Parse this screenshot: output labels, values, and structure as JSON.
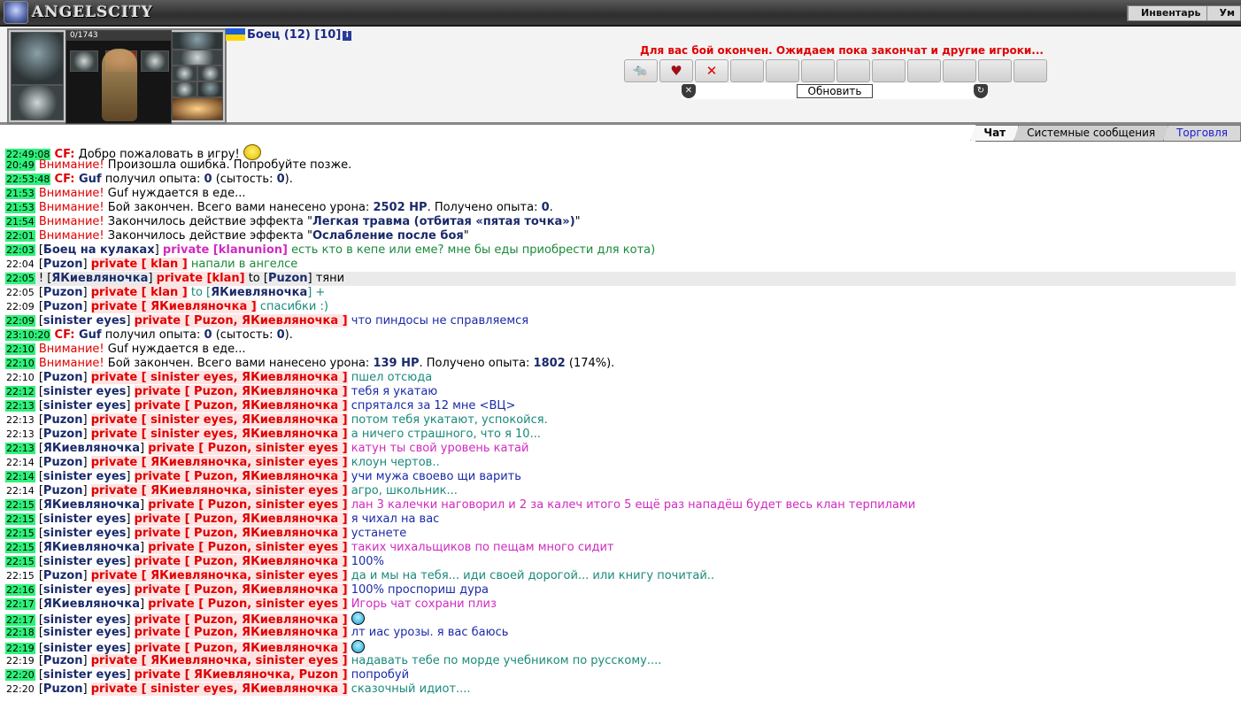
{
  "app": {
    "logo_text": "ANGELSCITY",
    "nav": [
      "Инвентарь",
      "Ум"
    ]
  },
  "player": {
    "name": "Боец (12) [10]",
    "info_icon": "i",
    "hp": "0/1743"
  },
  "battle": {
    "message": "Для вас бой окончен. Ожидаем пока закончат и другие игроки...",
    "refresh_label": "Обновить",
    "effect_icons": [
      "rat-icon",
      "heart-icon",
      "rat-cross-icon",
      "",
      "",
      "",
      "",
      "",
      "",
      "",
      "",
      "",
      ""
    ]
  },
  "tabs": [
    "Чат",
    "Системные сообщения",
    "Торговля"
  ],
  "chat": {
    "rows": [
      {
        "time": "22:49:08",
        "hl": true,
        "parts": [
          [
            "cf",
            "CF:"
          ],
          [
            "msg-black",
            " Добро пожаловать в игру! "
          ]
        ],
        "emoji": "big"
      },
      {
        "time": "20:49",
        "hl": true,
        "parts": [
          [
            "sys",
            "Внимание!"
          ],
          [
            "msg-black",
            " Произошла ошибка. Попробуйте позже."
          ]
        ]
      },
      {
        "time": "22:53:48",
        "hl": true,
        "parts": [
          [
            "cf",
            "CF:"
          ],
          [
            "nick",
            " Guf"
          ],
          [
            "msg-black",
            " получил опыта: "
          ],
          [
            "nick",
            "0"
          ],
          [
            "msg-black",
            " (сытость: "
          ],
          [
            "nick",
            "0"
          ],
          [
            "msg-black",
            ")."
          ]
        ]
      },
      {
        "time": "21:53",
        "hl": true,
        "parts": [
          [
            "sys",
            "Внимание!"
          ],
          [
            "msg-black",
            " Guf нуждается в еде..."
          ]
        ]
      },
      {
        "time": "21:53",
        "hl": true,
        "parts": [
          [
            "sys",
            "Внимание!"
          ],
          [
            "msg-black",
            " Бой закончен. Всего вами нанесено урона: "
          ],
          [
            "nick",
            "2502 HP"
          ],
          [
            "msg-black",
            ". Получено опыта: "
          ],
          [
            "nick",
            "0"
          ],
          [
            "msg-black",
            "."
          ]
        ]
      },
      {
        "time": "21:54",
        "hl": true,
        "parts": [
          [
            "sys",
            "Внимание!"
          ],
          [
            "msg-black",
            " Закончилось действие эффекта \""
          ],
          [
            "nick",
            "Легкая травма (отбитая «пятая точка»)"
          ],
          [
            "msg-black",
            "\""
          ]
        ]
      },
      {
        "time": "22:01",
        "hl": true,
        "parts": [
          [
            "sys",
            "Внимание!"
          ],
          [
            "msg-black",
            " Закончилось действие эффекта \""
          ],
          [
            "nick",
            "Ослабление после боя"
          ],
          [
            "msg-black",
            "\""
          ]
        ]
      },
      {
        "time": "22:03",
        "hl": true,
        "parts": [
          [
            "msg-black",
            "["
          ],
          [
            "nick",
            "Боец на кулаках"
          ],
          [
            "msg-black",
            "] "
          ],
          [
            "priv pink",
            "private [klanunion]"
          ],
          [
            "msg-green",
            " есть кто в кепе или еме? мне бы еды приобрести для кота)"
          ]
        ]
      },
      {
        "time": "22:04",
        "hl": false,
        "parts": [
          [
            "msg-black",
            "["
          ],
          [
            "nick",
            "Puzon"
          ],
          [
            "msg-black",
            "] "
          ],
          [
            "priv bg",
            "private [ klan ]"
          ],
          [
            "msg-green",
            " напали в ангелсе"
          ]
        ]
      },
      {
        "time": "22:05",
        "hl": true,
        "sel": true,
        "parts": [
          [
            "msg-black",
            "! ["
          ],
          [
            "nick",
            "ЯКиевляночка"
          ],
          [
            "msg-black",
            "] "
          ],
          [
            "priv bg",
            "private [klan]"
          ],
          [
            "msg-black",
            " to ["
          ],
          [
            "nick",
            "Puzon"
          ],
          [
            "msg-black",
            "] тяни"
          ]
        ]
      },
      {
        "time": "22:05",
        "hl": false,
        "parts": [
          [
            "msg-black",
            "["
          ],
          [
            "nick",
            "Puzon"
          ],
          [
            "msg-black",
            "] "
          ],
          [
            "priv bg",
            "private [ klan ]"
          ],
          [
            "msg-teal",
            " to ["
          ],
          [
            "nick",
            "ЯКиевляночка"
          ],
          [
            "msg-teal",
            "] +"
          ]
        ]
      },
      {
        "time": "22:09",
        "hl": false,
        "parts": [
          [
            "msg-black",
            "["
          ],
          [
            "nick",
            "Puzon"
          ],
          [
            "msg-black",
            "] "
          ],
          [
            "priv bg",
            "private [ ЯКиевляночка ]"
          ],
          [
            "msg-teal",
            " спасибки :)"
          ]
        ]
      },
      {
        "time": "22:09",
        "hl": true,
        "parts": [
          [
            "msg-black",
            "["
          ],
          [
            "nick",
            "sinister eyes"
          ],
          [
            "msg-black",
            "] "
          ],
          [
            "priv bg",
            "private [ Puzon, ЯКиевляночка ]"
          ],
          [
            "msg-blue",
            " что пиндосы не справляемся"
          ]
        ]
      },
      {
        "time": "23:10:20",
        "hl": true,
        "parts": [
          [
            "cf",
            "CF:"
          ],
          [
            "nick",
            " Guf"
          ],
          [
            "msg-black",
            " получил опыта: "
          ],
          [
            "nick",
            "0"
          ],
          [
            "msg-black",
            " (сытость: "
          ],
          [
            "nick",
            "0"
          ],
          [
            "msg-black",
            ")."
          ]
        ]
      },
      {
        "time": "22:10",
        "hl": true,
        "parts": [
          [
            "sys",
            "Внимание!"
          ],
          [
            "msg-black",
            " Guf нуждается в еде..."
          ]
        ]
      },
      {
        "time": "22:10",
        "hl": true,
        "parts": [
          [
            "sys",
            "Внимание!"
          ],
          [
            "msg-black",
            " Бой закончен. Всего вами нанесено урона: "
          ],
          [
            "nick",
            "139 HP"
          ],
          [
            "msg-black",
            ". Получено опыта: "
          ],
          [
            "nick",
            "1802"
          ],
          [
            "msg-black",
            " (174%)."
          ]
        ]
      },
      {
        "time": "22:10",
        "hl": false,
        "parts": [
          [
            "msg-black",
            "["
          ],
          [
            "nick",
            "Puzon"
          ],
          [
            "msg-black",
            "] "
          ],
          [
            "priv bg",
            "private [ sinister eyes, ЯКиевляночка ]"
          ],
          [
            "msg-teal",
            " пшел отсюда"
          ]
        ]
      },
      {
        "time": "22:12",
        "hl": true,
        "parts": [
          [
            "msg-black",
            "["
          ],
          [
            "nick",
            "sinister eyes"
          ],
          [
            "msg-black",
            "] "
          ],
          [
            "priv bg",
            "private [ Puzon, ЯКиевляночка ]"
          ],
          [
            "msg-blue",
            " тебя я укатаю"
          ]
        ]
      },
      {
        "time": "22:13",
        "hl": true,
        "parts": [
          [
            "msg-black",
            "["
          ],
          [
            "nick",
            "sinister eyes"
          ],
          [
            "msg-black",
            "] "
          ],
          [
            "priv bg",
            "private [ Puzon, ЯКиевляночка ]"
          ],
          [
            "msg-blue",
            " спрятался за 12 мне "
          ],
          [
            "msg-blue",
            "<ВЦ>"
          ]
        ]
      },
      {
        "time": "22:13",
        "hl": false,
        "parts": [
          [
            "msg-black",
            "["
          ],
          [
            "nick",
            "Puzon"
          ],
          [
            "msg-black",
            "] "
          ],
          [
            "priv bg",
            "private [ sinister eyes, ЯКиевляночка ]"
          ],
          [
            "msg-teal",
            " потом тебя укатают, успокойся."
          ]
        ]
      },
      {
        "time": "22:13",
        "hl": false,
        "parts": [
          [
            "msg-black",
            "["
          ],
          [
            "nick",
            "Puzon"
          ],
          [
            "msg-black",
            "] "
          ],
          [
            "priv bg",
            "private [ sinister eyes, ЯКиевляночка ]"
          ],
          [
            "msg-teal",
            " а ничего страшного, что я 10..."
          ]
        ]
      },
      {
        "time": "22:13",
        "hl": true,
        "parts": [
          [
            "msg-black",
            "["
          ],
          [
            "nick",
            "ЯКиевляночка"
          ],
          [
            "msg-black",
            "] "
          ],
          [
            "priv bg",
            "private [ Puzon, sinister eyes ]"
          ],
          [
            "msg-pink",
            " катун ты свой уровень катай"
          ]
        ]
      },
      {
        "time": "22:14",
        "hl": false,
        "parts": [
          [
            "msg-black",
            "["
          ],
          [
            "nick",
            "Puzon"
          ],
          [
            "msg-black",
            "] "
          ],
          [
            "priv bg",
            "private [ ЯКиевляночка, sinister eyes ]"
          ],
          [
            "msg-teal",
            " клоун чертов.."
          ]
        ]
      },
      {
        "time": "22:14",
        "hl": true,
        "parts": [
          [
            "msg-black",
            "["
          ],
          [
            "nick",
            "sinister eyes"
          ],
          [
            "msg-black",
            "] "
          ],
          [
            "priv bg",
            "private [ Puzon, ЯКиевляночка ]"
          ],
          [
            "msg-blue",
            " учи мужа своево щи варить"
          ]
        ]
      },
      {
        "time": "22:14",
        "hl": false,
        "parts": [
          [
            "msg-black",
            "["
          ],
          [
            "nick",
            "Puzon"
          ],
          [
            "msg-black",
            "] "
          ],
          [
            "priv bg",
            "private [ ЯКиевляночка, sinister eyes ]"
          ],
          [
            "msg-teal",
            " агро, школьник..."
          ]
        ]
      },
      {
        "time": "22:15",
        "hl": true,
        "parts": [
          [
            "msg-black",
            "["
          ],
          [
            "nick",
            "ЯКиевляночка"
          ],
          [
            "msg-black",
            "] "
          ],
          [
            "priv bg",
            "private [ Puzon, sinister eyes ]"
          ],
          [
            "msg-pink",
            " лан 3 калечки наговорил и 2 за калеч итого 5 ещё раз нападёш будет весь клан терпилами"
          ]
        ]
      },
      {
        "time": "22:15",
        "hl": true,
        "parts": [
          [
            "msg-black",
            "["
          ],
          [
            "nick",
            "sinister eyes"
          ],
          [
            "msg-black",
            "] "
          ],
          [
            "priv bg",
            "private [ Puzon, ЯКиевляночка ]"
          ],
          [
            "msg-blue",
            " я чихал на вас"
          ]
        ]
      },
      {
        "time": "22:15",
        "hl": true,
        "parts": [
          [
            "msg-black",
            "["
          ],
          [
            "nick",
            "sinister eyes"
          ],
          [
            "msg-black",
            "] "
          ],
          [
            "priv bg",
            "private [ Puzon, ЯКиевляночка ]"
          ],
          [
            "msg-blue",
            " устанете"
          ]
        ]
      },
      {
        "time": "22:15",
        "hl": true,
        "parts": [
          [
            "msg-black",
            "["
          ],
          [
            "nick",
            "ЯКиевляночка"
          ],
          [
            "msg-black",
            "] "
          ],
          [
            "priv bg",
            "private [ Puzon, sinister eyes ]"
          ],
          [
            "msg-pink",
            " таких чихальщиков по пещам много сидит"
          ]
        ]
      },
      {
        "time": "22:15",
        "hl": true,
        "parts": [
          [
            "msg-black",
            "["
          ],
          [
            "nick",
            "sinister eyes"
          ],
          [
            "msg-black",
            "] "
          ],
          [
            "priv bg",
            "private [ Puzon, ЯКиевляночка ]"
          ],
          [
            "msg-blue",
            " 100%"
          ]
        ]
      },
      {
        "time": "22:15",
        "hl": false,
        "parts": [
          [
            "msg-black",
            "["
          ],
          [
            "nick",
            "Puzon"
          ],
          [
            "msg-black",
            "] "
          ],
          [
            "priv bg",
            "private [ ЯКиевляночка, sinister eyes ]"
          ],
          [
            "msg-teal",
            " да и мы на тебя... иди своей дорогой... или книгу почитай.."
          ]
        ]
      },
      {
        "time": "22:16",
        "hl": true,
        "parts": [
          [
            "msg-black",
            "["
          ],
          [
            "nick",
            "sinister eyes"
          ],
          [
            "msg-black",
            "] "
          ],
          [
            "priv bg",
            "private [ Puzon, ЯКиевляночка ]"
          ],
          [
            "msg-blue",
            " 100% проспориш дура"
          ]
        ]
      },
      {
        "time": "22:17",
        "hl": true,
        "parts": [
          [
            "msg-black",
            "["
          ],
          [
            "nick",
            "ЯКиевляночка"
          ],
          [
            "msg-black",
            "] "
          ],
          [
            "priv bg",
            "private [ Puzon, sinister eyes ]"
          ],
          [
            "msg-pink",
            " Игорь чат сохрани плиз"
          ]
        ]
      },
      {
        "time": "22:17",
        "hl": true,
        "parts": [
          [
            "msg-black",
            "["
          ],
          [
            "nick",
            "sinister eyes"
          ],
          [
            "msg-black",
            "] "
          ],
          [
            "priv bg",
            "private [ Puzon, ЯКиевляночка ]"
          ],
          [
            "msg-blue",
            " "
          ]
        ],
        "emoji": "small"
      },
      {
        "time": "22:18",
        "hl": true,
        "parts": [
          [
            "msg-black",
            "["
          ],
          [
            "nick",
            "sinister eyes"
          ],
          [
            "msg-black",
            "] "
          ],
          [
            "priv bg",
            "private [ Puzon, ЯКиевляночка ]"
          ],
          [
            "msg-blue",
            " лт иас урозы. я вас баюсь"
          ]
        ]
      },
      {
        "time": "22:19",
        "hl": true,
        "parts": [
          [
            "msg-black",
            "["
          ],
          [
            "nick",
            "sinister eyes"
          ],
          [
            "msg-black",
            "] "
          ],
          [
            "priv bg",
            "private [ Puzon, ЯКиевляночка ]"
          ],
          [
            "msg-blue",
            " "
          ]
        ],
        "emoji": "small"
      },
      {
        "time": "22:19",
        "hl": false,
        "parts": [
          [
            "msg-black",
            "["
          ],
          [
            "nick",
            "Puzon"
          ],
          [
            "msg-black",
            "] "
          ],
          [
            "priv bg",
            "private [ ЯКиевляночка, sinister eyes ]"
          ],
          [
            "msg-teal",
            " надавать тебе по морде учебником по русскому...."
          ]
        ]
      },
      {
        "time": "22:20",
        "hl": true,
        "parts": [
          [
            "msg-black",
            "["
          ],
          [
            "nick",
            "sinister eyes"
          ],
          [
            "msg-black",
            "] "
          ],
          [
            "priv bg",
            "private [ ЯКиевляночка, Puzon ]"
          ],
          [
            "msg-blue",
            " попробуй"
          ]
        ]
      },
      {
        "time": "22:20",
        "hl": false,
        "parts": [
          [
            "msg-black",
            "["
          ],
          [
            "nick",
            "Puzon"
          ],
          [
            "msg-black",
            "] "
          ],
          [
            "priv bg",
            "private [ sinister eyes, ЯКиевляночка ]"
          ],
          [
            "msg-teal",
            " сказочный идиот...."
          ]
        ]
      }
    ]
  }
}
